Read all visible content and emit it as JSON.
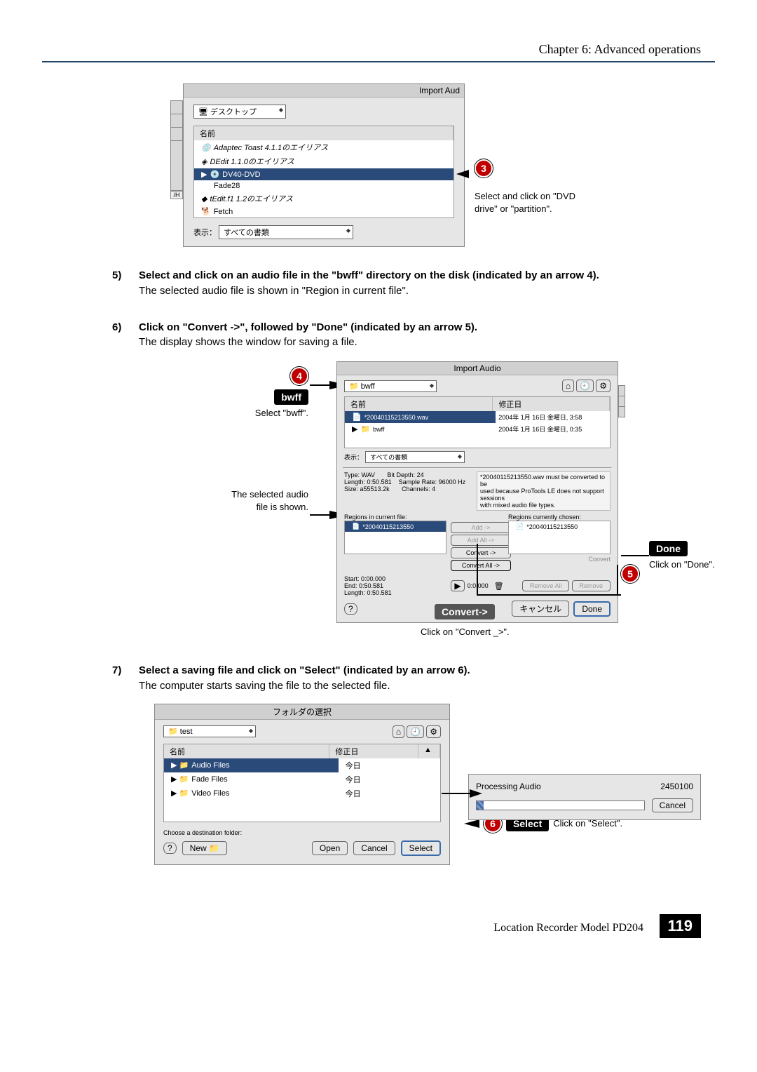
{
  "header": {
    "chapter_title": "Chapter 6: Advanced operations"
  },
  "fig1": {
    "window_title": "Import Aud",
    "location_popup": "デスクトップ",
    "column_header": "名前",
    "rows": {
      "r1": "Adaptec Toast 4.1.1のエイリアス",
      "r2": "DEdit 1.1.0のエイリアス",
      "r3": "DV40-DVD",
      "r4": "Fade28",
      "r5": "tEdit.f1 1.2のエイリアス",
      "r6": "Fetch"
    },
    "show_label": "表示：",
    "show_popup": "すべての書類",
    "lefttab": "/H"
  },
  "annot3": {
    "badge": "3",
    "line1": "Select and click on \"DVD",
    "line2": "drive\" or \"partition\"."
  },
  "step5": {
    "num": "5)",
    "bold": "Select and click on an audio file in the \"bwff\" directory on the disk (indicated by an arrow 4).",
    "body": "The selected audio file is shown in \"Region in current file\"."
  },
  "step6": {
    "num": "6)",
    "bold": "Click on \"Convert ->\", followed by \"Done\" (indicated by an arrow 5).",
    "body": "The display shows the window for saving a file."
  },
  "fig2": {
    "badge4": "4",
    "bwff_label": "bwff",
    "select_bwff": "Select \"bwff\".",
    "selected_audio_l1": "The selected audio",
    "selected_audio_l2": "file is shown.",
    "badge5": "5",
    "done_label": "Done",
    "done_annot": "Click on \"Done\".",
    "convert_label": "Convert->",
    "convert_annot": "Click on \"Convert _>\".",
    "window_title": "Import Audio",
    "location_popup": "bwff",
    "col_name": "名前",
    "col_date": "修正日",
    "row_file": "*20040115213550.wav",
    "row_folder": "bwff",
    "date1": "2004年 1月 16日 金曜日, 3:58",
    "date2": "2004年 1月 16日 金曜日, 0:35",
    "show_label": "表示：",
    "show_popup": "すべての書類",
    "type_label": "Type:",
    "type_val": "WAV",
    "length_label": "Length:",
    "length_val": "0:50.581",
    "size_label": "Size:",
    "size_val": "a55513.2k",
    "bitdepth_label": "Bit Depth:",
    "bitdepth_val": "24",
    "srate_label": "Sample Rate:",
    "srate_val": "96000 Hz",
    "channels_label": "Channels:",
    "channels_val": "4",
    "warn_l1": "*20040115213550.wav must be converted to be",
    "warn_l2": "used because ProTools LE does not support sessions",
    "warn_l3": "with mixed audio file types.",
    "regions_in_file": "Regions in current file:",
    "region_item": "*20040115213550",
    "regions_chosen": "Regions currently chosen:",
    "chosen_item": "*20040115213550",
    "btn_add": "Add ->",
    "btn_add_all": "Add All ->",
    "btn_convert": "Convert ->",
    "btn_convert_all": "Convert All ->",
    "start_label": "Start:",
    "start_val": "0:00.000",
    "end_label": "End:",
    "end_val": "0:50.581",
    "length2_label": "Length:",
    "length2_val": "0:50.581",
    "play_time": "0:0.000",
    "btn_remove_all": "Remove All",
    "btn_remove": "Remove",
    "btn_cancel": "キャンセル",
    "btn_done": "Done"
  },
  "step7": {
    "num": "7)",
    "bold": "Select a saving file and click on \"Select\" (indicated by an arrow 6).",
    "body": "The computer starts saving the file to the selected file."
  },
  "fig3": {
    "window_title": "フォルダの選択",
    "location_popup": "test",
    "col_name": "名前",
    "col_date": "修正日",
    "row1": "Audio Files",
    "row2": "Fade Files",
    "row3": "Video Files",
    "row_date": "今日",
    "choose_label": "Choose a destination folder:",
    "btn_new": "New",
    "btn_open": "Open",
    "btn_cancel": "Cancel",
    "btn_select": "Select",
    "badge6": "6",
    "select_label": "Select",
    "select_annot": "Click on \"Select\"."
  },
  "progress": {
    "label": "Processing Audio",
    "value": "2450100",
    "cancel": "Cancel"
  },
  "footer": {
    "text": "Location Recorder  Model PD204",
    "page": "119"
  }
}
